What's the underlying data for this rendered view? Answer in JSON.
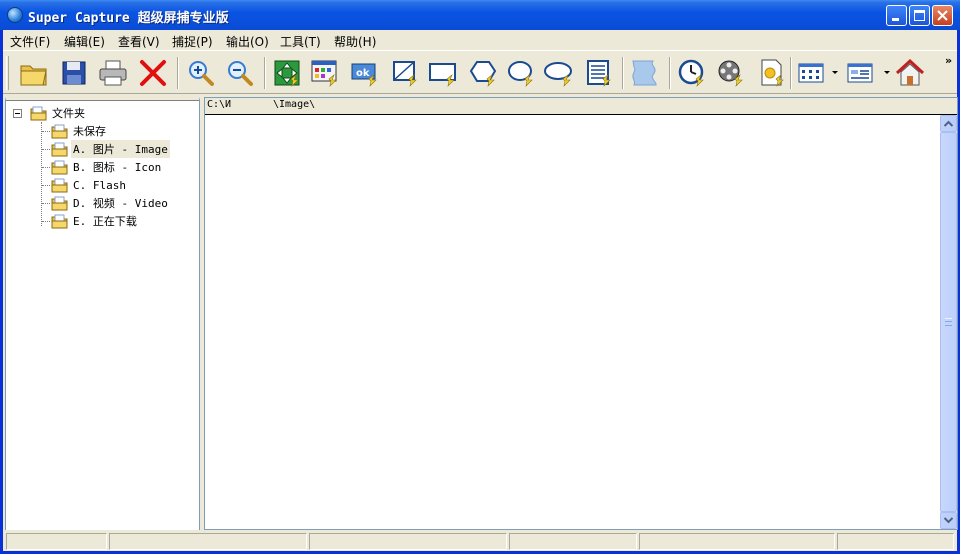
{
  "window": {
    "title": "Super Capture 超级屏捕专业版"
  },
  "titlebar": {
    "buttons": [
      "minimize",
      "maximize",
      "close"
    ]
  },
  "menu": {
    "items": [
      "文件(F)",
      "编辑(E)",
      "查看(V)",
      "捕捉(P)",
      "输出(O)",
      "工具(T)",
      "帮助(H)"
    ]
  },
  "toolbar": {
    "icons": [
      "open-folder-icon",
      "save-disk-icon",
      "printer-icon",
      "delete-x-icon",
      "zoom-in-icon",
      "zoom-out-icon",
      "capture-fullscreen-icon",
      "capture-window-icon",
      "capture-button-icon",
      "capture-rectangle-icon",
      "capture-fixed-region-icon",
      "capture-polygon-icon",
      "capture-ellipse-icon",
      "capture-rounded-rect-icon",
      "capture-scroll-icon",
      "capture-freehand-icon",
      "timer-capture-icon",
      "video-capture-icon",
      "image-capture-icon",
      "grid-view-icon",
      "details-view-icon",
      "home-icon"
    ],
    "overflow": "»"
  },
  "tree": {
    "root": "文件夹",
    "items": [
      {
        "label": "未保存",
        "selected": false
      },
      {
        "label": "A. 图片 - Image",
        "selected": true
      },
      {
        "label": "B. 图标 - Icon",
        "selected": false
      },
      {
        "label": "C. Flash",
        "selected": false
      },
      {
        "label": "D. 视频 - Video",
        "selected": false
      },
      {
        "label": "E. 正在下载",
        "selected": false
      }
    ]
  },
  "content": {
    "path_prefix": "C:\\И",
    "path_suffix": "\\Image\\"
  },
  "statusbar": {
    "cells": [
      "",
      "",
      "",
      "",
      "",
      ""
    ]
  },
  "colors": {
    "titlebar": "#0a54e3",
    "frame": "#0831d9",
    "face": "#ece9d8",
    "close": "#c5401e"
  }
}
